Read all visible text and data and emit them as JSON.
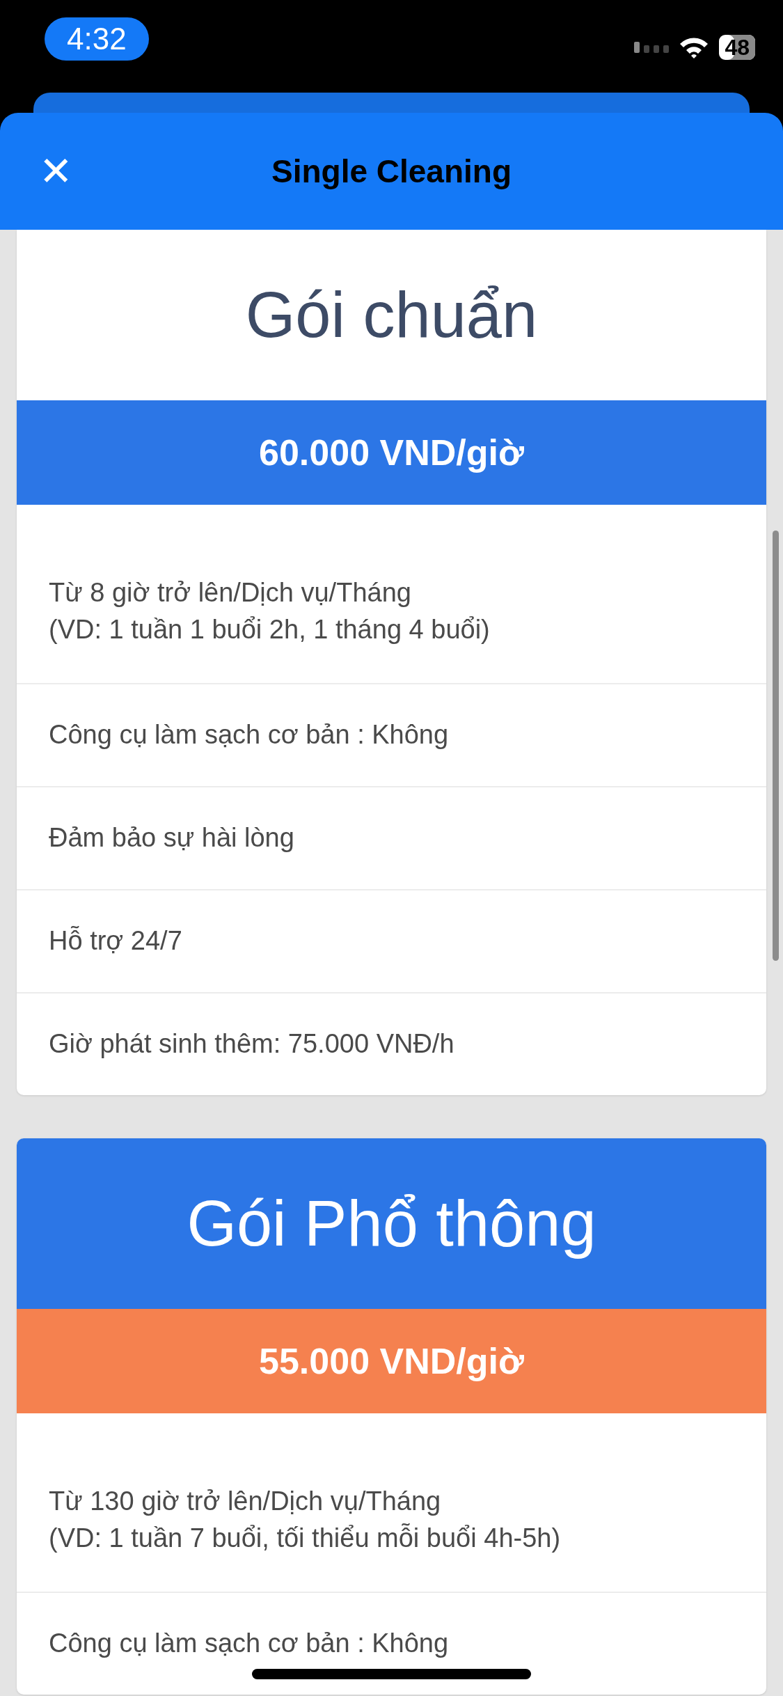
{
  "status_bar": {
    "time": "4:32",
    "battery": "48"
  },
  "header": {
    "title": "Single Cleaning",
    "close_icon": "✕"
  },
  "packages": [
    {
      "title": "Gói chuẩn",
      "kind": "plain",
      "price": "60.000 VND/giờ",
      "color": "#2c76e6",
      "features": [
        "Từ 8 giờ trở lên/Dịch vụ/Tháng\n(VD: 1 tuần 1 buổi 2h, 1 tháng 4 buổi)",
        "Công cụ làm sạch cơ bản : Không",
        "Đảm bảo sự hài lòng",
        "Hỗ trợ 24/7",
        "Giờ phát sinh thêm: 75.000 VNĐ/h"
      ]
    },
    {
      "title": "Gói Phổ thông",
      "kind": "banner",
      "price": "55.000 VND/giờ",
      "color": "#f5814f",
      "features": [
        "Từ 130 giờ trở lên/Dịch vụ/Tháng\n(VD: 1 tuần 7 buổi, tối thiểu mỗi buổi 4h-5h)",
        "Công cụ làm sạch cơ bản : Không"
      ]
    }
  ]
}
